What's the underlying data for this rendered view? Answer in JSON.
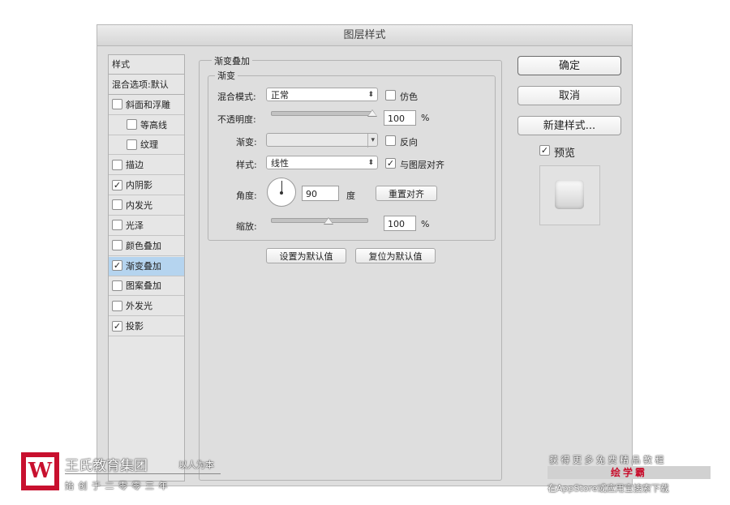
{
  "dialog": {
    "title": "图层样式"
  },
  "sidebar": {
    "items": [
      {
        "label": "样式",
        "checkbox": false,
        "checked": false,
        "indent": false,
        "selected": false
      },
      {
        "label": "混合选项:默认",
        "checkbox": false,
        "checked": false,
        "indent": false,
        "selected": false
      },
      {
        "label": "斜面和浮雕",
        "checkbox": true,
        "checked": false,
        "indent": false,
        "selected": false
      },
      {
        "label": "等高线",
        "checkbox": true,
        "checked": false,
        "indent": true,
        "selected": false
      },
      {
        "label": "纹理",
        "checkbox": true,
        "checked": false,
        "indent": true,
        "selected": false
      },
      {
        "label": "描边",
        "checkbox": true,
        "checked": false,
        "indent": false,
        "selected": false
      },
      {
        "label": "内阴影",
        "checkbox": true,
        "checked": true,
        "indent": false,
        "selected": false
      },
      {
        "label": "内发光",
        "checkbox": true,
        "checked": false,
        "indent": false,
        "selected": false
      },
      {
        "label": "光泽",
        "checkbox": true,
        "checked": false,
        "indent": false,
        "selected": false
      },
      {
        "label": "颜色叠加",
        "checkbox": true,
        "checked": false,
        "indent": false,
        "selected": false
      },
      {
        "label": "渐变叠加",
        "checkbox": true,
        "checked": true,
        "indent": false,
        "selected": true
      },
      {
        "label": "图案叠加",
        "checkbox": true,
        "checked": false,
        "indent": false,
        "selected": false
      },
      {
        "label": "外发光",
        "checkbox": true,
        "checked": false,
        "indent": false,
        "selected": false
      },
      {
        "label": "投影",
        "checkbox": true,
        "checked": true,
        "indent": false,
        "selected": false
      }
    ]
  },
  "panel": {
    "group_title": "渐变叠加",
    "subgroup_title": "渐变",
    "blend_mode": {
      "label": "混合模式:",
      "value": "正常"
    },
    "dither": {
      "label": "仿色",
      "checked": false
    },
    "opacity": {
      "label": "不透明度:",
      "value": "100",
      "unit": "%",
      "level": 1.0
    },
    "gradient": {
      "label": "渐变:"
    },
    "reverse": {
      "label": "反向",
      "checked": false
    },
    "style": {
      "label": "样式:",
      "value": "线性"
    },
    "align": {
      "label": "与图层对齐",
      "checked": true
    },
    "angle": {
      "label": "角度:",
      "value": "90",
      "unit": "度",
      "reset_label": "重置对齐"
    },
    "scale": {
      "label": "缩放:",
      "value": "100",
      "unit": "%",
      "level": 0.6
    },
    "set_default_label": "设置为默认值",
    "reset_default_label": "复位为默认值"
  },
  "buttons": {
    "ok": "确定",
    "cancel": "取消",
    "new_style": "新建样式...",
    "preview": {
      "label": "预览",
      "checked": true
    }
  },
  "watermark": {
    "left_name": "王氏教育集团",
    "left_slogan": "以人为本",
    "left_sub": "始 创 于 二 零 零 三 年",
    "right_top": "获 得 更 多 免 费 精 品 教 程",
    "right_brand": "绘学霸",
    "right_bottom": "在AppStore或应用宝搜索下载"
  }
}
